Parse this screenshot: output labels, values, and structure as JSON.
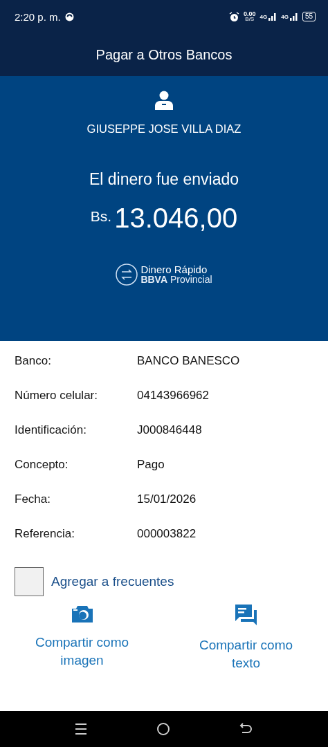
{
  "status_bar": {
    "time": "2:20 p. m.",
    "speed_value": "0.00",
    "speed_unit": "B/S",
    "network_1": "4G",
    "network_2": "4G",
    "battery": "55"
  },
  "header": {
    "title": "Pagar a Otros Bancos"
  },
  "summary": {
    "recipient": "GIUSEPPE JOSE VILLA DIAZ",
    "message": "El dinero fue enviado",
    "currency": "Bs.",
    "amount": "13.046,00",
    "brand_line_1": "Dinero Rápido",
    "brand_line_2": "**BBVA** Provincial"
  },
  "details": [
    {
      "label": "Banco:",
      "value": "BANCO BANESCO"
    },
    {
      "label": "Número celular:",
      "value": "04143966962"
    },
    {
      "label": "Identificación:",
      "value": "J000846448"
    },
    {
      "label": "Concepto:",
      "value": "Pago"
    },
    {
      "label": "Fecha:",
      "value": "15/01/2026"
    },
    {
      "label": "Referencia:",
      "value": "000003822"
    }
  ],
  "favorite": {
    "label": "Agregar a frecuentes",
    "checked": false
  },
  "share_actions": [
    {
      "kind": "image",
      "label": "Compartir como imagen"
    },
    {
      "kind": "text",
      "label": "Compartir como texto"
    }
  ]
}
